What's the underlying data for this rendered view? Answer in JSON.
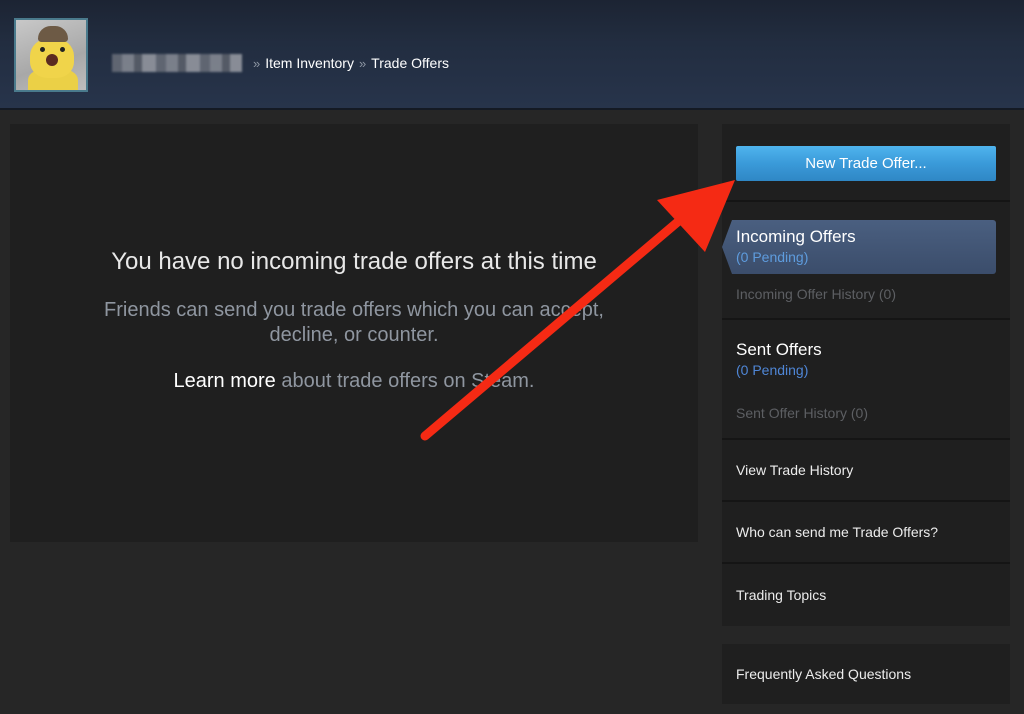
{
  "header": {
    "username_blurred": true,
    "breadcrumb": [
      {
        "label": "Item Inventory"
      },
      {
        "label": "Trade Offers"
      }
    ],
    "separator": "»"
  },
  "main": {
    "empty_title": "You have no incoming trade offers at this time",
    "empty_description": "Friends can send you trade offers which you can accept, decline, or counter.",
    "learn_more_link": "Learn more",
    "learn_more_suffix": " about trade offers on Steam."
  },
  "sidebar": {
    "new_trade_offer_button": "New Trade Offer...",
    "incoming": {
      "title": "Incoming Offers",
      "pending": "(0 Pending)",
      "history": "Incoming Offer History (0)"
    },
    "sent": {
      "title": "Sent Offers",
      "pending": "(0 Pending)",
      "history": "Sent Offer History (0)"
    },
    "links": [
      {
        "label": "View Trade History"
      },
      {
        "label": "Who can send me Trade Offers?"
      },
      {
        "label": "Trading Topics"
      }
    ],
    "faq": "Frequently Asked Questions"
  },
  "annotation": {
    "type": "arrow",
    "color": "#f52a14",
    "points_to": "new-trade-offer-button"
  },
  "colors": {
    "accent_button": "#3a9ad9",
    "pending_text": "#5e9cde",
    "active_tab": "#415470"
  }
}
